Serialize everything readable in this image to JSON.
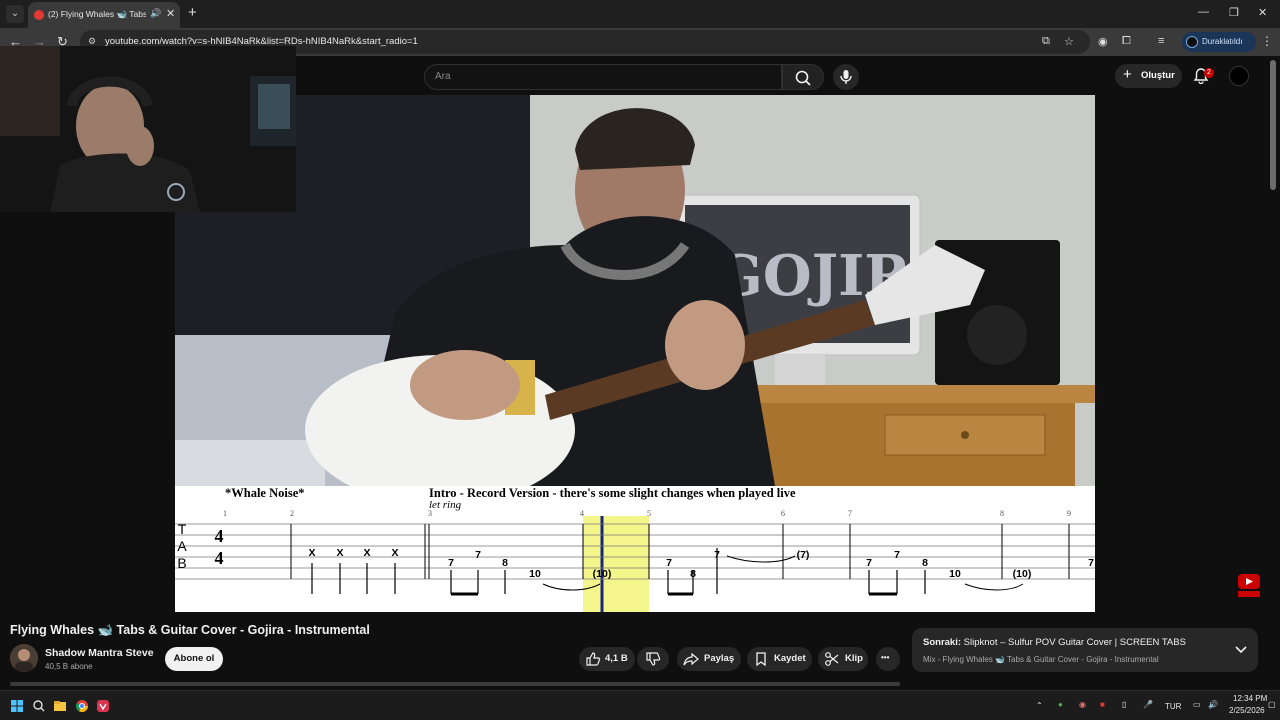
{
  "browser": {
    "tab_title": "(2) Flying Whales 🐋 Tabs & Guitar Cover - Gojira - Instrumental",
    "new_tab": "+",
    "url": "youtube.com/watch?v=s-hNIB4NaRk&list=RDs-hNIB4NaRk&start_radio=1",
    "profile_label": "Duraklatıldı"
  },
  "youtube": {
    "search_placeholder": "Ara",
    "create_label": "Oluştur",
    "notification_count": "2"
  },
  "tab_sheet": {
    "title_left": "*Whale Noise*",
    "title_main": "Intro - Record Version - there's some slight changes when played live",
    "let_ring": "let ring",
    "measure_numbers": [
      "1",
      "2",
      "3",
      "4",
      "5",
      "6",
      "7",
      "8",
      "9"
    ],
    "clef": [
      "T",
      "A",
      "B"
    ],
    "time_sig": [
      "4",
      "4"
    ],
    "notes": [
      "X",
      "X",
      "X",
      "X",
      "7",
      "7",
      "8",
      "10",
      "(10)",
      "7",
      "8",
      "7",
      "(7)",
      "7",
      "7",
      "8",
      "10",
      "(10)",
      "7"
    ]
  },
  "video": {
    "title": "Flying Whales 🐋 Tabs & Guitar Cover - Gojira - Instrumental",
    "channel": "Shadow Mantra Steve",
    "subscribers": "40,5 B abone",
    "subscribe_label": "Abone ol",
    "likes": "4,1 B",
    "share_label": "Paylaş",
    "save_label": "Kaydet",
    "clip_label": "Klip",
    "more_label": "•••"
  },
  "next_up": {
    "prefix": "Sonraki:",
    "title": "Slipknot – Sulfur POV Guitar Cover | SCREEN TABS",
    "subtitle": "Mix - Flying Whales 🐋 Tabs & Guitar Cover - Gojira - Instrumental"
  },
  "taskbar": {
    "language": "TUR",
    "time": "12:34 PM",
    "date": "2/25/2026"
  },
  "colors": {
    "accent_red": "#cc0000",
    "playhead": "#1a237e",
    "highlight": "#f4f58a"
  }
}
